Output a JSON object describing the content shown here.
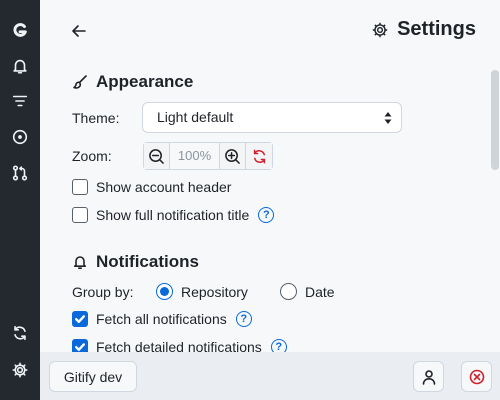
{
  "header": {
    "title": "Settings"
  },
  "appearance": {
    "heading": "Appearance",
    "theme_label": "Theme:",
    "theme_value": "Light default",
    "zoom_label": "Zoom:",
    "zoom_value": "100%",
    "show_account_header": {
      "label": "Show account header",
      "checked": false
    },
    "show_full_title": {
      "label": "Show full notification title",
      "checked": false
    }
  },
  "notifications": {
    "heading": "Notifications",
    "group_by_label": "Group by:",
    "group_options": [
      {
        "label": "Repository",
        "selected": true
      },
      {
        "label": "Date",
        "selected": false
      }
    ],
    "fetch_all": {
      "label": "Fetch all notifications",
      "checked": true
    },
    "fetch_detailed": {
      "label": "Fetch detailed notifications",
      "checked": true
    }
  },
  "footer": {
    "account_button": "Gitify dev"
  },
  "colors": {
    "sidebar": "#24292f",
    "accent": "#0969da",
    "danger": "#cf222e"
  },
  "icons": {
    "sidebar": [
      "gitify-logo-icon",
      "bell-icon",
      "filter-icon",
      "issue-icon",
      "pull-request-icon",
      "refresh-icon",
      "gear-icon"
    ],
    "header": [
      "arrow-left-icon",
      "gear-icon"
    ],
    "zoom": [
      "zoom-out-icon",
      "zoom-in-icon",
      "reset-zoom-icon"
    ],
    "footer": [
      "person-icon",
      "quit-icon"
    ]
  }
}
